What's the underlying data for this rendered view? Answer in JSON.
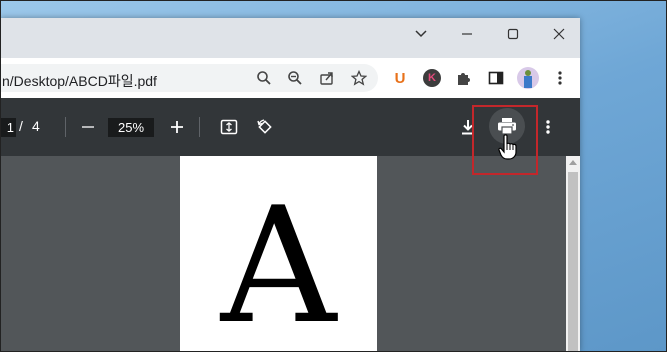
{
  "window": {
    "controls": {
      "tabs_dropdown": "chevron-down",
      "minimize": "minimize",
      "maximize": "maximize",
      "close": "close"
    }
  },
  "address_bar": {
    "url": "n/Desktop/ABCD파일.pdf",
    "icons": [
      "search-icon",
      "zoom-out-icon",
      "share-icon",
      "bookmark-star-icon"
    ],
    "extensions": [
      {
        "name": "U",
        "color": "#e8711a"
      },
      {
        "name": "K",
        "color": "#e34a7b"
      }
    ]
  },
  "pdf_toolbar": {
    "current_page": "1",
    "page_separator": "/",
    "total_pages": "4",
    "zoom_level": "25%",
    "zoom_out_label": "—",
    "zoom_in_label": "+"
  },
  "document": {
    "visible_letter": "A"
  },
  "colors": {
    "highlight": "#c3272b",
    "toolbar": "#323639",
    "viewer_bg": "#525659"
  }
}
